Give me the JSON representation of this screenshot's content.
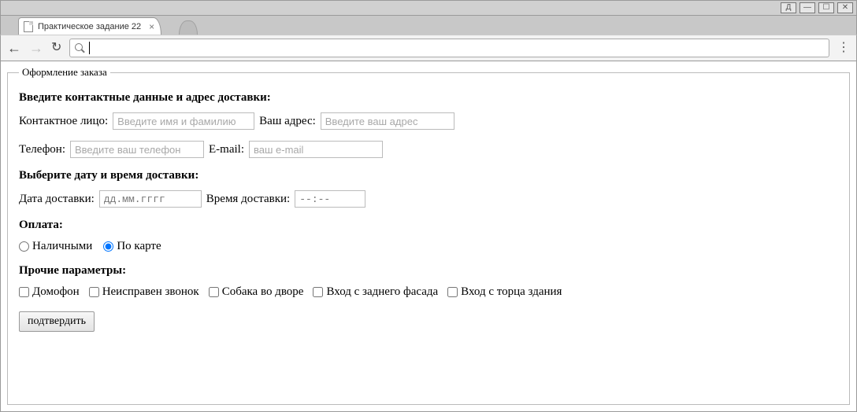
{
  "window": {
    "app_indicator": "Д",
    "min": "—",
    "max": "☐",
    "close": "✕"
  },
  "tab": {
    "title": "Практическое задание 22",
    "close": "×"
  },
  "toolbar": {
    "back": "←",
    "forward": "→",
    "reload": "↻",
    "kebab": "⋮",
    "url_value": ""
  },
  "form": {
    "legend": "Оформление заказа",
    "section_contact": "Введите контактные данные и адрес доставки:",
    "contact_label": "Контактное лицо:",
    "contact_placeholder": "Введите имя и фамилию",
    "address_label": "Ваш адрес:",
    "address_placeholder": "Введите ваш адрес",
    "phone_label": "Телефон:",
    "phone_placeholder": "Введите ваш телефон",
    "email_label": "E-mail:",
    "email_placeholder": "ваш e-mail",
    "section_datetime": "Выберите дату и время доставки:",
    "date_label": "Дата доставки:",
    "date_placeholder": "дд.мм.гггг",
    "time_label": "Время доставки:",
    "time_placeholder": "--:--",
    "section_payment": "Оплата:",
    "pay_cash": "Наличными",
    "pay_card": "По карте",
    "section_other": "Прочие параметры:",
    "chk_intercom": "Домофон",
    "chk_bell": "Неисправен звонок",
    "chk_dog": "Собака во дворе",
    "chk_back": "Вход с заднего фасада",
    "chk_side": "Вход с торца здания",
    "submit": "подтвердить"
  }
}
